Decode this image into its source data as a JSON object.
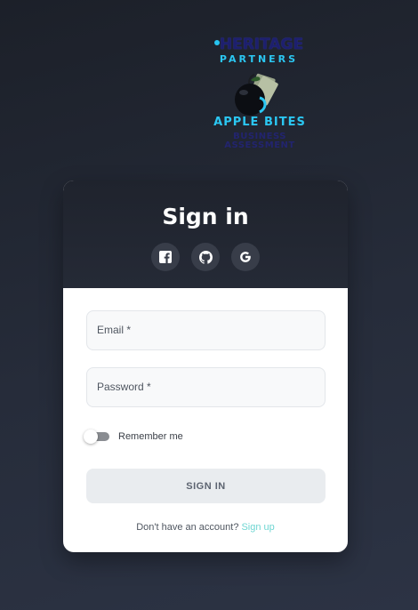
{
  "logo": {
    "line1": "HERITAGE",
    "line2": "PARTNERS",
    "line3": "APPLE BITES",
    "line4a": "BUSINESS",
    "line4b": "ASSESSMENT",
    "accent_color": "#2bc7f2",
    "dark_color": "#1d1f6e"
  },
  "card": {
    "title": "Sign in",
    "socials": [
      {
        "icon": "facebook-icon"
      },
      {
        "icon": "github-icon"
      },
      {
        "icon": "google-icon"
      }
    ],
    "email": {
      "label": "Email *",
      "value": ""
    },
    "password": {
      "label": "Password *",
      "value": ""
    },
    "remember": {
      "label": "Remember me",
      "checked": false
    },
    "submit_label": "SIGN IN",
    "signup_prompt": "Don't have an account?",
    "signup_link": "Sign up",
    "link_color": "#6fd6d2"
  }
}
